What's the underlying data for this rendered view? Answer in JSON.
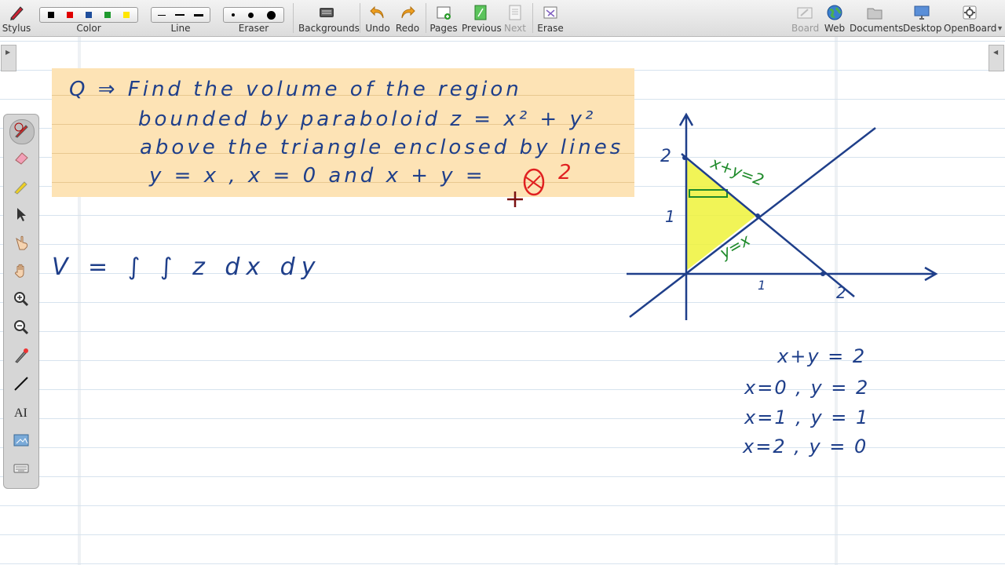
{
  "app": {
    "name": "OpenBoard"
  },
  "toolbar": {
    "stylus": "Stylus",
    "color": "Color",
    "line": "Line",
    "eraser": "Eraser",
    "backgrounds": "Backgrounds",
    "undo": "Undo",
    "redo": "Redo",
    "pages": "Pages",
    "previous": "Previous",
    "next": "Next",
    "erase": "Erase",
    "board": "Board",
    "web": "Web",
    "documents": "Documents",
    "desktop": "Desktop",
    "openboard": "OpenBoard",
    "colors": [
      "#000000",
      "#e00000",
      "#1f4e9c",
      "#1f9a2e",
      "#ffe600"
    ]
  },
  "handwriting": {
    "question_line1": "Q ⇒ Find the volume of the region",
    "question_line2": "bounded by paraboloid z = x² + y²",
    "question_line3": "above the triangle enclosed by lines",
    "question_line4a": "y = x , x = 0 and x + y =",
    "question_correction": "2",
    "integral_formula": "V = ∫ ∫ z dx dy",
    "graph_label_line1": "x+y=2",
    "graph_label_line2": "y=x",
    "axis_tick_y2": "2",
    "axis_tick_y1": "1",
    "axis_tick_x1": "1",
    "axis_tick_x2": "2",
    "calc_line1": "x+y = 2",
    "calc_line2": "x=0 ,   y = 2",
    "calc_line3": "x=1 ,   y = 1",
    "calc_line4": "x=2 ,   y = 0"
  },
  "colors": {
    "ink_blue": "#1f3f8a",
    "ink_green": "#1e8a2a",
    "ink_red": "#e02020",
    "highlight_yellow": "#eef23a",
    "note_bg": "#fde3b5"
  }
}
